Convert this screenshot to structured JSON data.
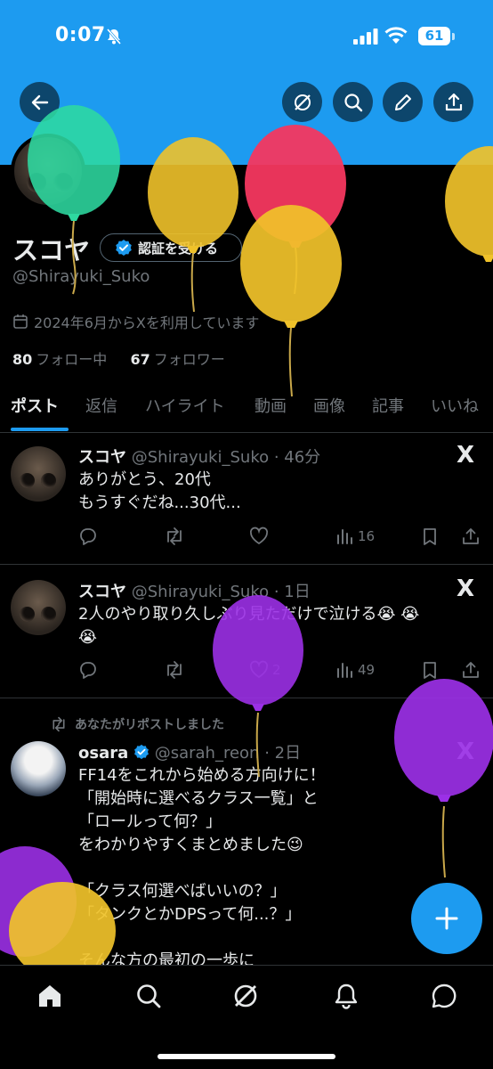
{
  "status_bar": {
    "time": "0:07",
    "battery": "61"
  },
  "profile": {
    "display_name": "スコヤ",
    "verify_label": "認証を受ける",
    "handle": "@Shirayuki_Suko",
    "joined": "2024年6月からXを利用しています",
    "following_count": "80",
    "following_label": "フォロー中",
    "followers_count": "67",
    "followers_label": "フォロワー"
  },
  "tabs": [
    {
      "label": "ポスト",
      "active": true
    },
    {
      "label": "返信"
    },
    {
      "label": "ハイライト"
    },
    {
      "label": "動画"
    },
    {
      "label": "画像"
    },
    {
      "label": "記事"
    },
    {
      "label": "いいね"
    }
  ],
  "posts": [
    {
      "name": "スコヤ",
      "meta": "@Shirayuki_Suko · 46分",
      "text": "ありがとう、20代\nもうすぐだね...30代...",
      "views": "16",
      "likes": ""
    },
    {
      "name": "スコヤ",
      "meta": "@Shirayuki_Suko · 1日",
      "text": "2人のやり取り久しぶり見ただけで泣ける😭 😭\n😭",
      "views": "49",
      "likes": "2"
    },
    {
      "repost_label": "あなたがリポストしました",
      "name": "osara",
      "meta": "@sarah_reon · 2日",
      "text": "FF14をこれから始める方向けに！\n「開始時に選べるクラス一覧」と\n「ロールって何？」\nをわかりやすくまとめました😉\n\n「クラス何選べばいいの？」\n「タンクとかDPSって何...？」\n\nそんな方の最初の一歩に"
    }
  ],
  "x_mark": "X",
  "colors": {
    "accent": "#1d9bf0",
    "balloon_green": "#2ed9a0",
    "balloon_yellow": "#f0c22a",
    "balloon_red": "#f4375f",
    "balloon_purple": "#9b30e6"
  },
  "icons": {
    "back": "arrow-left-icon",
    "grok": "grok-icon",
    "search": "search-icon",
    "edit": "pencil-icon",
    "share": "share-icon",
    "nav": [
      "home-icon",
      "search-icon",
      "grok-icon",
      "bell-icon",
      "message-icon"
    ]
  }
}
